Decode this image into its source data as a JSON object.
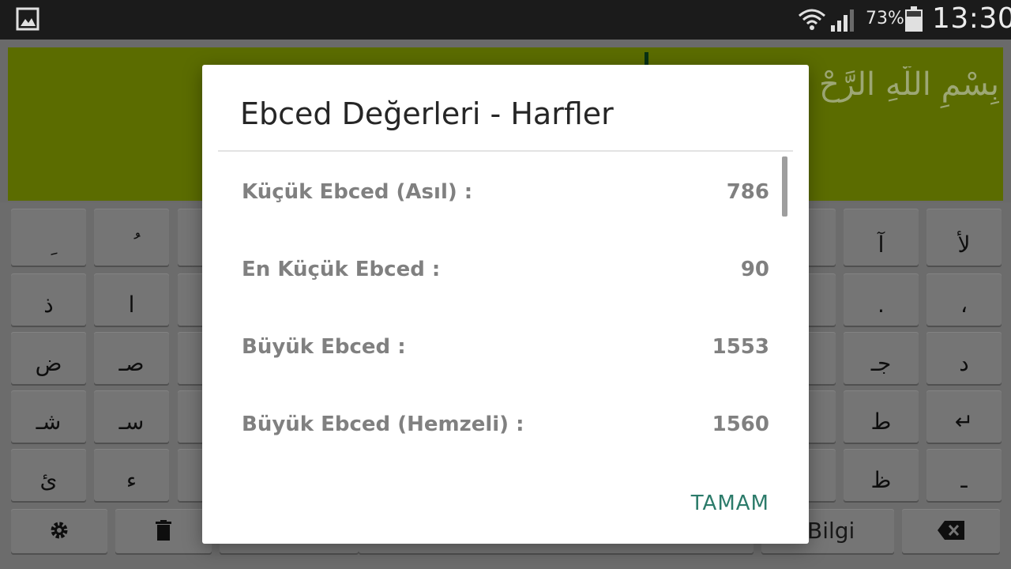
{
  "status_bar": {
    "battery_percent": "73%",
    "time": "13:30",
    "icons": [
      "gallery-icon",
      "wifi-icon",
      "signal-icon",
      "battery-icon"
    ]
  },
  "background": {
    "basmala": "بِسْمِ اللَّهِ الرَّحْ"
  },
  "keyboard": {
    "rows": [
      [
        "ِ",
        "ُ",
        "",
        "",
        "",
        "",
        "",
        "",
        "",
        "",
        "آ",
        "لأ"
      ],
      [
        "ذ",
        "ا",
        "",
        "",
        "",
        "",
        "",
        "",
        "",
        "",
        ".",
        "،"
      ],
      [
        "ض",
        "صـ",
        "",
        "",
        "",
        "",
        "",
        "",
        "",
        "",
        "جـ",
        "د"
      ],
      [
        "شـ",
        "سـ",
        "",
        "",
        "",
        "",
        "",
        "",
        "",
        "",
        "ط",
        "↵"
      ],
      [
        "ئ",
        "ء",
        "",
        "",
        "",
        "",
        "",
        "",
        "",
        "",
        "ظ",
        "ـ"
      ]
    ],
    "bottom": {
      "settings_icon": "gear-icon",
      "delete_icon": "trash-icon",
      "info_label": "Bilgi",
      "backspace_icon": "backspace-icon"
    }
  },
  "dialog": {
    "title": "Ebced Değerleri - Harfler",
    "rows": [
      {
        "label": "Küçük Ebced (Asıl) :",
        "value": "786"
      },
      {
        "label": "En Küçük Ebced :",
        "value": "90"
      },
      {
        "label": "Büyük Ebced :",
        "value": "1553"
      },
      {
        "label": "Büyük Ebced (Hemzeli) :",
        "value": "1560"
      }
    ],
    "ok_label": "TAMAM"
  },
  "colors": {
    "accent": "#2c7b6a",
    "green_panel": "#6b7f00",
    "status_bar": "#1b1b1b"
  }
}
